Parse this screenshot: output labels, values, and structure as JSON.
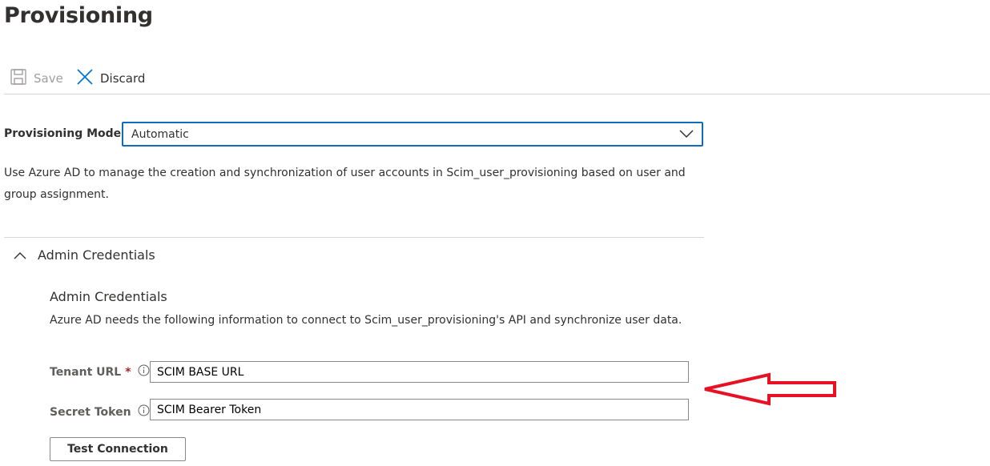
{
  "page": {
    "title": "Provisioning"
  },
  "toolbar": {
    "save_label": "Save",
    "discard_label": "Discard"
  },
  "provisioning_mode": {
    "label": "Provisioning Mode",
    "selected": "Automatic",
    "description": "Use Azure AD to manage the creation and synchronization of user accounts in Scim_user_provisioning based on user and group assignment."
  },
  "admin_section": {
    "toggle_label": "Admin Credentials",
    "expanded": true,
    "subtitle": "Admin Credentials",
    "description": "Azure AD needs the following information to connect to Scim_user_provisioning's API and synchronize user data.",
    "fields": {
      "tenant_url": {
        "label": "Tenant URL",
        "required_marker": "*",
        "value": "SCIM BASE URL"
      },
      "secret_token": {
        "label": "Secret Token",
        "value": "SCIM Bearer Token"
      }
    },
    "test_button_label": "Test Connection"
  },
  "colors": {
    "accent": "#0f6cbd",
    "discard_icon": "#0078d4",
    "required": "#a4262c",
    "annotation_arrow": "#e81123"
  }
}
